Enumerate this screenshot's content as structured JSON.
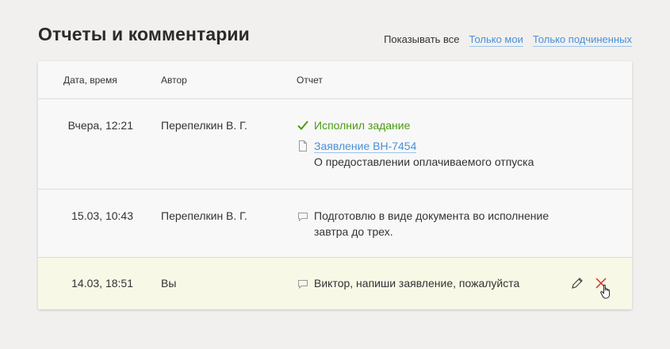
{
  "header": {
    "title": "Отчеты и комментарии",
    "filters": {
      "all": "Показывать все",
      "mine": "Только мои",
      "subordinates": "Только подчиненных"
    }
  },
  "table": {
    "columns": {
      "date": "Дата, время",
      "author": "Автор",
      "report": "Отчет"
    },
    "rows": [
      {
        "date": "Вчера, 12:21",
        "author": "Перепелкин В. Г.",
        "status": "Исполнил задание",
        "doc_link": "Заявление ВН-7454",
        "doc_desc": "О предоставлении оплачиваемого отпуска"
      },
      {
        "date": "15.03, 10:43",
        "author": "Перепелкин В. Г.",
        "comment_line1": "Подготовлю в виде документа во исполнение",
        "comment_line2": "завтра до трех."
      },
      {
        "date": "14.03, 18:51",
        "author": "Вы",
        "comment": "Виктор, напиши заявление, пожалуйста"
      }
    ]
  },
  "icons": {
    "status": "checkmark-icon",
    "document": "document-icon",
    "comment": "comment-icon",
    "edit": "pencil-icon",
    "delete": "close-icon",
    "cursor": "hand-cursor-icon"
  },
  "colors": {
    "background": "#f1f0ee",
    "card": "#f8f8f8",
    "highlight_row": "#f7f8e6",
    "link": "#4a90d9",
    "success": "#4c9a12",
    "delete": "#d0312d"
  }
}
